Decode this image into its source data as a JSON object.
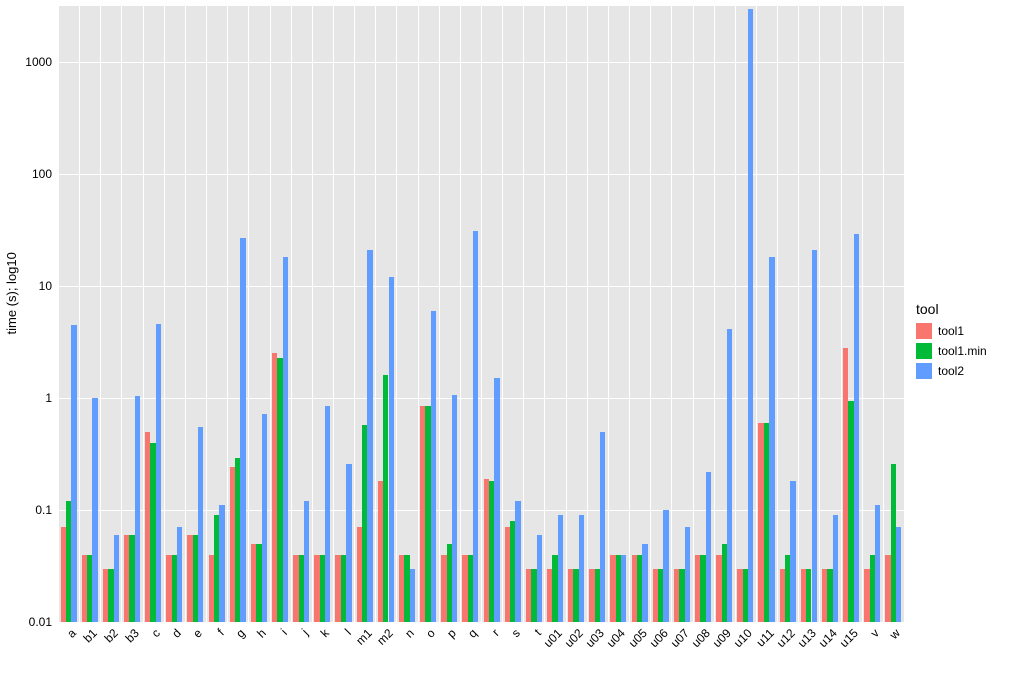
{
  "chart_data": {
    "type": "bar",
    "ylabel": "time (s); log10",
    "y_scale": "log10",
    "ylim_log10": [
      -2,
      3.5
    ],
    "y_ticks": [
      0.01,
      0.1,
      1,
      10,
      100,
      1000
    ],
    "y_tick_labels": [
      "0.01",
      "0.1",
      "1",
      "10",
      "100",
      "1000"
    ],
    "legend_title": "tool",
    "categories": [
      "a",
      "b1",
      "b2",
      "b3",
      "c",
      "d",
      "e",
      "f",
      "g",
      "h",
      "i",
      "j",
      "k",
      "l",
      "m1",
      "m2",
      "n",
      "o",
      "p",
      "q",
      "r",
      "s",
      "t",
      "u01",
      "u02",
      "u03",
      "u04",
      "u05",
      "u06",
      "u07",
      "u08",
      "u09",
      "u10",
      "u11",
      "u12",
      "u13",
      "u14",
      "u15",
      "v",
      "w"
    ],
    "series": [
      {
        "name": "tool1",
        "color": "#F8766D",
        "values": [
          0.07,
          0.04,
          0.03,
          0.06,
          0.5,
          0.04,
          0.06,
          0.04,
          0.24,
          0.05,
          2.5,
          0.04,
          0.04,
          0.04,
          0.07,
          0.18,
          0.04,
          0.85,
          0.04,
          0.04,
          0.19,
          0.07,
          0.03,
          0.03,
          0.03,
          0.03,
          0.04,
          0.04,
          0.03,
          0.03,
          0.04,
          0.04,
          0.03,
          0.6,
          0.03,
          0.03,
          0.03,
          2.8,
          0.03,
          0.04
        ]
      },
      {
        "name": "tool1.min",
        "color": "#00BA38",
        "values": [
          0.12,
          0.04,
          0.03,
          0.06,
          0.4,
          0.04,
          0.06,
          0.09,
          0.29,
          0.05,
          2.3,
          0.04,
          0.04,
          0.04,
          0.58,
          1.6,
          0.04,
          0.85,
          0.05,
          0.04,
          0.18,
          0.08,
          0.03,
          0.04,
          0.03,
          0.03,
          0.04,
          0.04,
          0.03,
          0.03,
          0.04,
          0.05,
          0.03,
          0.6,
          0.04,
          0.03,
          0.03,
          0.95,
          0.04,
          0.26
        ]
      },
      {
        "name": "tool2",
        "color": "#619CFF",
        "values": [
          4.5,
          1.0,
          0.06,
          1.05,
          4.6,
          0.07,
          0.55,
          0.11,
          27.0,
          0.72,
          18.0,
          0.12,
          0.85,
          0.26,
          21.0,
          12.0,
          0.03,
          6.0,
          1.07,
          31.0,
          1.5,
          0.12,
          0.06,
          0.09,
          0.09,
          0.5,
          0.04,
          0.05,
          0.1,
          0.07,
          0.22,
          4.1,
          3000.0,
          18.0,
          0.18,
          21.0,
          0.09,
          29.0,
          0.11,
          0.07
        ]
      }
    ]
  },
  "colors": {
    "panel_bg": "#e6e6e6",
    "grid": "#ffffff"
  }
}
